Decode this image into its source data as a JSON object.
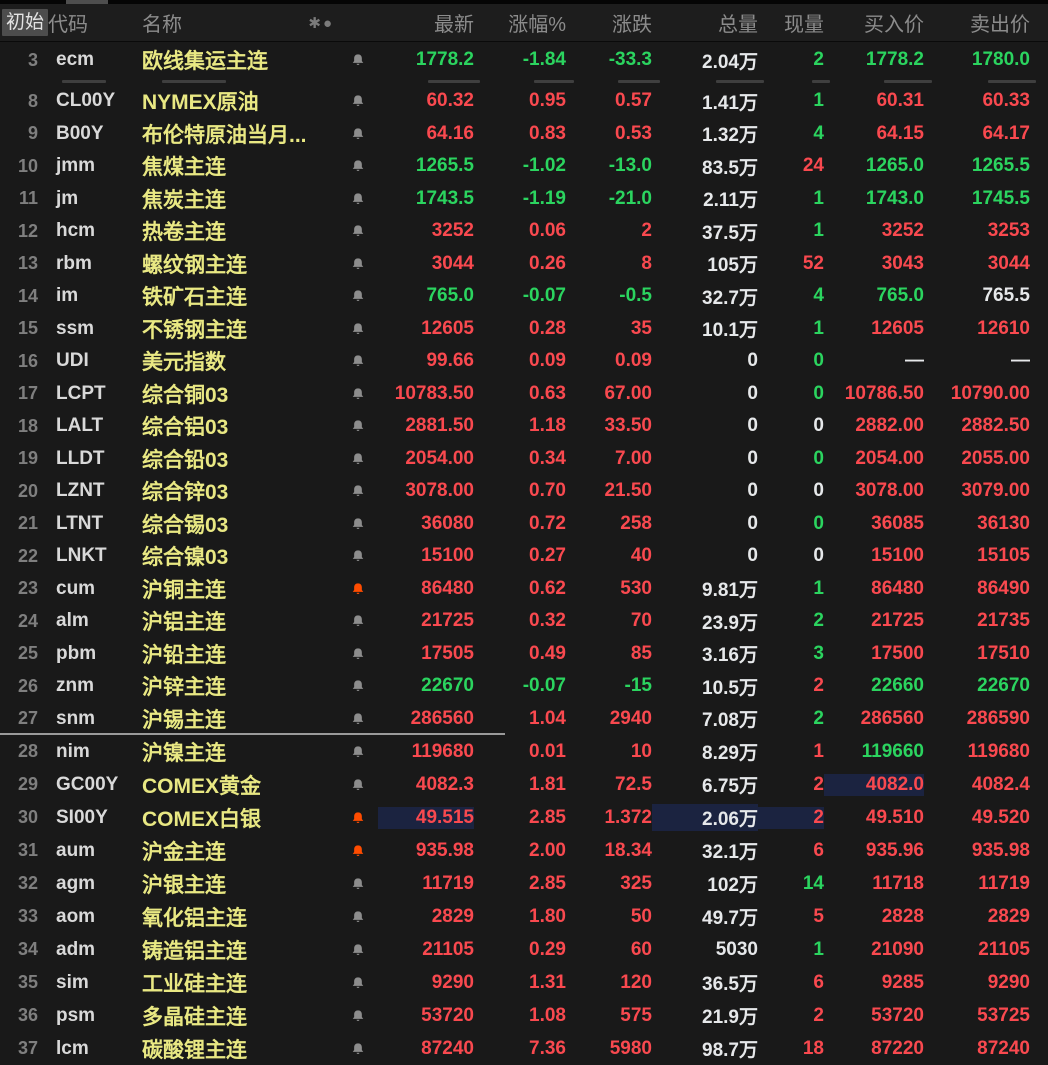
{
  "header": {
    "initial_label": "初始",
    "columns": {
      "code": "代码",
      "name": "名称",
      "last": "最新",
      "pct": "涨幅%",
      "chg": "涨跌",
      "vol": "总量",
      "cur": "现量",
      "bid": "买入价",
      "ask": "卖出价"
    },
    "icons": {
      "asterisk": "✱",
      "dot": "●"
    }
  },
  "colors": {
    "up_green": "#2bd45f",
    "down_red": "#f9494f",
    "neutral_white": "#e6e8ea",
    "name_yellow": "#e9e883",
    "alert_orange": "#ff4c00",
    "highlight_navy": "#1b2340"
  },
  "rows": [
    {
      "pane": "top",
      "num": "3",
      "code": "ecm",
      "name": "欧线集运主连",
      "bell": "gray",
      "last": "1778.2",
      "last_c": "g",
      "pct": "-1.84",
      "pct_c": "g",
      "chg": "-33.3",
      "chg_c": "g",
      "vol": "2.04万",
      "vol_c": "w",
      "cur": "2",
      "cur_c": "g",
      "bid": "1778.2",
      "bid_c": "g",
      "ask": "1780.0",
      "ask_c": "g"
    },
    {
      "pane": "mid",
      "num": "8",
      "code": "CL00Y",
      "name": "NYMEX原油",
      "bell": "gray",
      "last": "60.32",
      "last_c": "r",
      "pct": "0.95",
      "pct_c": "r",
      "chg": "0.57",
      "chg_c": "r",
      "vol": "1.41万",
      "vol_c": "w",
      "cur": "1",
      "cur_c": "g",
      "bid": "60.31",
      "bid_c": "r",
      "ask": "60.33",
      "ask_c": "r"
    },
    {
      "pane": "mid",
      "num": "9",
      "code": "B00Y",
      "name": "布伦特原油当月...",
      "bell": "gray",
      "last": "64.16",
      "last_c": "r",
      "pct": "0.83",
      "pct_c": "r",
      "chg": "0.53",
      "chg_c": "r",
      "vol": "1.32万",
      "vol_c": "w",
      "cur": "4",
      "cur_c": "g",
      "bid": "64.15",
      "bid_c": "r",
      "ask": "64.17",
      "ask_c": "r"
    },
    {
      "pane": "mid",
      "num": "10",
      "code": "jmm",
      "name": "焦煤主连",
      "bell": "gray",
      "last": "1265.5",
      "last_c": "g",
      "pct": "-1.02",
      "pct_c": "g",
      "chg": "-13.0",
      "chg_c": "g",
      "vol": "83.5万",
      "vol_c": "w",
      "cur": "24",
      "cur_c": "r",
      "bid": "1265.0",
      "bid_c": "g",
      "ask": "1265.5",
      "ask_c": "g"
    },
    {
      "pane": "mid",
      "num": "11",
      "code": "jm",
      "name": "焦炭主连",
      "bell": "gray",
      "last": "1743.5",
      "last_c": "g",
      "pct": "-1.19",
      "pct_c": "g",
      "chg": "-21.0",
      "chg_c": "g",
      "vol": "2.11万",
      "vol_c": "w",
      "cur": "1",
      "cur_c": "g",
      "bid": "1743.0",
      "bid_c": "g",
      "ask": "1745.5",
      "ask_c": "g"
    },
    {
      "pane": "mid",
      "num": "12",
      "code": "hcm",
      "name": "热卷主连",
      "bell": "gray",
      "last": "3252",
      "last_c": "r",
      "pct": "0.06",
      "pct_c": "r",
      "chg": "2",
      "chg_c": "r",
      "vol": "37.5万",
      "vol_c": "w",
      "cur": "1",
      "cur_c": "g",
      "bid": "3252",
      "bid_c": "r",
      "ask": "3253",
      "ask_c": "r"
    },
    {
      "pane": "mid",
      "num": "13",
      "code": "rbm",
      "name": "螺纹钢主连",
      "bell": "gray",
      "last": "3044",
      "last_c": "r",
      "pct": "0.26",
      "pct_c": "r",
      "chg": "8",
      "chg_c": "r",
      "vol": "105万",
      "vol_c": "w",
      "cur": "52",
      "cur_c": "r",
      "bid": "3043",
      "bid_c": "r",
      "ask": "3044",
      "ask_c": "r"
    },
    {
      "pane": "mid",
      "num": "14",
      "code": "im",
      "name": "铁矿石主连",
      "bell": "gray",
      "last": "765.0",
      "last_c": "g",
      "pct": "-0.07",
      "pct_c": "g",
      "chg": "-0.5",
      "chg_c": "g",
      "vol": "32.7万",
      "vol_c": "w",
      "cur": "4",
      "cur_c": "g",
      "bid": "765.0",
      "bid_c": "g",
      "ask": "765.5",
      "ask_c": "w"
    },
    {
      "pane": "mid",
      "num": "15",
      "code": "ssm",
      "name": "不锈钢主连",
      "bell": "gray",
      "last": "12605",
      "last_c": "r",
      "pct": "0.28",
      "pct_c": "r",
      "chg": "35",
      "chg_c": "r",
      "vol": "10.1万",
      "vol_c": "w",
      "cur": "1",
      "cur_c": "g",
      "bid": "12605",
      "bid_c": "r",
      "ask": "12610",
      "ask_c": "r"
    },
    {
      "pane": "mid",
      "num": "16",
      "code": "UDI",
      "name": "美元指数",
      "bell": "gray",
      "last": "99.66",
      "last_c": "r",
      "pct": "0.09",
      "pct_c": "r",
      "chg": "0.09",
      "chg_c": "r",
      "vol": "0",
      "vol_c": "w",
      "cur": "0",
      "cur_c": "g",
      "bid": "—",
      "bid_c": "w",
      "ask": "—",
      "ask_c": "w"
    },
    {
      "pane": "mid",
      "num": "17",
      "code": "LCPT",
      "name": "综合铜03",
      "bell": "gray",
      "last": "10783.50",
      "last_c": "r",
      "pct": "0.63",
      "pct_c": "r",
      "chg": "67.00",
      "chg_c": "r",
      "vol": "0",
      "vol_c": "w",
      "cur": "0",
      "cur_c": "g",
      "bid": "10786.50",
      "bid_c": "r",
      "ask": "10790.00",
      "ask_c": "r"
    },
    {
      "pane": "mid",
      "num": "18",
      "code": "LALT",
      "name": "综合铝03",
      "bell": "gray",
      "last": "2881.50",
      "last_c": "r",
      "pct": "1.18",
      "pct_c": "r",
      "chg": "33.50",
      "chg_c": "r",
      "vol": "0",
      "vol_c": "w",
      "cur": "0",
      "cur_c": "w",
      "bid": "2882.00",
      "bid_c": "r",
      "ask": "2882.50",
      "ask_c": "r"
    },
    {
      "pane": "mid",
      "num": "19",
      "code": "LLDT",
      "name": "综合铅03",
      "bell": "gray",
      "last": "2054.00",
      "last_c": "r",
      "pct": "0.34",
      "pct_c": "r",
      "chg": "7.00",
      "chg_c": "r",
      "vol": "0",
      "vol_c": "w",
      "cur": "0",
      "cur_c": "g",
      "bid": "2054.00",
      "bid_c": "r",
      "ask": "2055.00",
      "ask_c": "r"
    },
    {
      "pane": "mid",
      "num": "20",
      "code": "LZNT",
      "name": "综合锌03",
      "bell": "gray",
      "last": "3078.00",
      "last_c": "r",
      "pct": "0.70",
      "pct_c": "r",
      "chg": "21.50",
      "chg_c": "r",
      "vol": "0",
      "vol_c": "w",
      "cur": "0",
      "cur_c": "w",
      "bid": "3078.00",
      "bid_c": "r",
      "ask": "3079.00",
      "ask_c": "r"
    },
    {
      "pane": "mid",
      "num": "21",
      "code": "LTNT",
      "name": "综合锡03",
      "bell": "gray",
      "last": "36080",
      "last_c": "r",
      "pct": "0.72",
      "pct_c": "r",
      "chg": "258",
      "chg_c": "r",
      "vol": "0",
      "vol_c": "w",
      "cur": "0",
      "cur_c": "g",
      "bid": "36085",
      "bid_c": "r",
      "ask": "36130",
      "ask_c": "r"
    },
    {
      "pane": "mid",
      "num": "22",
      "code": "LNKT",
      "name": "综合镍03",
      "bell": "gray",
      "last": "15100",
      "last_c": "r",
      "pct": "0.27",
      "pct_c": "r",
      "chg": "40",
      "chg_c": "r",
      "vol": "0",
      "vol_c": "w",
      "cur": "0",
      "cur_c": "w",
      "bid": "15100",
      "bid_c": "r",
      "ask": "15105",
      "ask_c": "r"
    },
    {
      "pane": "mid",
      "num": "23",
      "code": "cum",
      "name": "沪铜主连",
      "bell": "orange",
      "last": "86480",
      "last_c": "r",
      "pct": "0.62",
      "pct_c": "r",
      "chg": "530",
      "chg_c": "r",
      "vol": "9.81万",
      "vol_c": "w",
      "cur": "1",
      "cur_c": "g",
      "bid": "86480",
      "bid_c": "r",
      "ask": "86490",
      "ask_c": "r"
    },
    {
      "pane": "mid",
      "num": "24",
      "code": "alm",
      "name": "沪铝主连",
      "bell": "gray",
      "last": "21725",
      "last_c": "r",
      "pct": "0.32",
      "pct_c": "r",
      "chg": "70",
      "chg_c": "r",
      "vol": "23.9万",
      "vol_c": "w",
      "cur": "2",
      "cur_c": "g",
      "bid": "21725",
      "bid_c": "r",
      "ask": "21735",
      "ask_c": "r"
    },
    {
      "pane": "mid",
      "num": "25",
      "code": "pbm",
      "name": "沪铅主连",
      "bell": "gray",
      "last": "17505",
      "last_c": "r",
      "pct": "0.49",
      "pct_c": "r",
      "chg": "85",
      "chg_c": "r",
      "vol": "3.16万",
      "vol_c": "w",
      "cur": "3",
      "cur_c": "g",
      "bid": "17500",
      "bid_c": "r",
      "ask": "17510",
      "ask_c": "r"
    },
    {
      "pane": "mid",
      "num": "26",
      "code": "znm",
      "name": "沪锌主连",
      "bell": "gray",
      "last": "22670",
      "last_c": "g",
      "pct": "-0.07",
      "pct_c": "g",
      "chg": "-15",
      "chg_c": "g",
      "vol": "10.5万",
      "vol_c": "w",
      "cur": "2",
      "cur_c": "r",
      "bid": "22660",
      "bid_c": "g",
      "ask": "22670",
      "ask_c": "g"
    },
    {
      "pane": "mid",
      "num": "27",
      "code": "snm",
      "name": "沪锡主连",
      "bell": "gray",
      "last": "286560",
      "last_c": "r",
      "pct": "1.04",
      "pct_c": "r",
      "chg": "2940",
      "chg_c": "r",
      "vol": "7.08万",
      "vol_c": "w",
      "cur": "2",
      "cur_c": "g",
      "bid": "286560",
      "bid_c": "r",
      "ask": "286590",
      "ask_c": "r"
    },
    {
      "pane": "bot",
      "num": "28",
      "code": "nim",
      "name": "沪镍主连",
      "bell": "gray",
      "last": "119680",
      "last_c": "r",
      "pct": "0.01",
      "pct_c": "r",
      "chg": "10",
      "chg_c": "r",
      "vol": "8.29万",
      "vol_c": "w",
      "cur": "1",
      "cur_c": "r",
      "bid": "119660",
      "bid_c": "g",
      "ask": "119680",
      "ask_c": "r"
    },
    {
      "pane": "bot",
      "num": "29",
      "code": "GC00Y",
      "name": "COMEX黄金",
      "bell": "gray",
      "last": "4082.3",
      "last_c": "r",
      "pct": "1.81",
      "pct_c": "r",
      "chg": "72.5",
      "chg_c": "r",
      "vol": "6.75万",
      "vol_c": "w",
      "cur": "2",
      "cur_c": "r",
      "bid": "4082.0",
      "bid_c": "r",
      "ask": "4082.4",
      "ask_c": "r",
      "hl": [
        "bid"
      ]
    },
    {
      "pane": "bot",
      "num": "30",
      "code": "SI00Y",
      "name": "COMEX白银",
      "bell": "orange",
      "last": "49.515",
      "last_c": "r",
      "pct": "2.85",
      "pct_c": "r",
      "chg": "1.372",
      "chg_c": "r",
      "vol": "2.06万",
      "vol_c": "w",
      "cur": "2",
      "cur_c": "r",
      "bid": "49.510",
      "bid_c": "r",
      "ask": "49.520",
      "ask_c": "r",
      "hl": [
        "last",
        "vol",
        "cur"
      ]
    },
    {
      "pane": "bot",
      "num": "31",
      "code": "aum",
      "name": "沪金主连",
      "bell": "orange",
      "last": "935.98",
      "last_c": "r",
      "pct": "2.00",
      "pct_c": "r",
      "chg": "18.34",
      "chg_c": "r",
      "vol": "32.1万",
      "vol_c": "w",
      "cur": "6",
      "cur_c": "r",
      "bid": "935.96",
      "bid_c": "r",
      "ask": "935.98",
      "ask_c": "r"
    },
    {
      "pane": "bot",
      "num": "32",
      "code": "agm",
      "name": "沪银主连",
      "bell": "gray",
      "last": "11719",
      "last_c": "r",
      "pct": "2.85",
      "pct_c": "r",
      "chg": "325",
      "chg_c": "r",
      "vol": "102万",
      "vol_c": "w",
      "cur": "14",
      "cur_c": "g",
      "bid": "11718",
      "bid_c": "r",
      "ask": "11719",
      "ask_c": "r"
    },
    {
      "pane": "bot",
      "num": "33",
      "code": "aom",
      "name": "氧化铝主连",
      "bell": "gray",
      "last": "2829",
      "last_c": "r",
      "pct": "1.80",
      "pct_c": "r",
      "chg": "50",
      "chg_c": "r",
      "vol": "49.7万",
      "vol_c": "w",
      "cur": "5",
      "cur_c": "r",
      "bid": "2828",
      "bid_c": "r",
      "ask": "2829",
      "ask_c": "r"
    },
    {
      "pane": "bot",
      "num": "34",
      "code": "adm",
      "name": "铸造铝主连",
      "bell": "gray",
      "last": "21105",
      "last_c": "r",
      "pct": "0.29",
      "pct_c": "r",
      "chg": "60",
      "chg_c": "r",
      "vol": "5030",
      "vol_c": "w",
      "cur": "1",
      "cur_c": "g",
      "bid": "21090",
      "bid_c": "r",
      "ask": "21105",
      "ask_c": "r"
    },
    {
      "pane": "bot",
      "num": "35",
      "code": "sim",
      "name": "工业硅主连",
      "bell": "gray",
      "last": "9290",
      "last_c": "r",
      "pct": "1.31",
      "pct_c": "r",
      "chg": "120",
      "chg_c": "r",
      "vol": "36.5万",
      "vol_c": "w",
      "cur": "6",
      "cur_c": "r",
      "bid": "9285",
      "bid_c": "r",
      "ask": "9290",
      "ask_c": "r"
    },
    {
      "pane": "bot",
      "num": "36",
      "code": "psm",
      "name": "多晶硅主连",
      "bell": "gray",
      "last": "53720",
      "last_c": "r",
      "pct": "1.08",
      "pct_c": "r",
      "chg": "575",
      "chg_c": "r",
      "vol": "21.9万",
      "vol_c": "w",
      "cur": "2",
      "cur_c": "r",
      "bid": "53720",
      "bid_c": "r",
      "ask": "53725",
      "ask_c": "r"
    },
    {
      "pane": "bot",
      "num": "37",
      "code": "lcm",
      "name": "碳酸锂主连",
      "bell": "gray",
      "last": "87240",
      "last_c": "r",
      "pct": "7.36",
      "pct_c": "r",
      "chg": "5980",
      "chg_c": "r",
      "vol": "98.7万",
      "vol_c": "w",
      "cur": "18",
      "cur_c": "r",
      "bid": "87220",
      "bid_c": "r",
      "ask": "87240",
      "ask_c": "r"
    }
  ]
}
